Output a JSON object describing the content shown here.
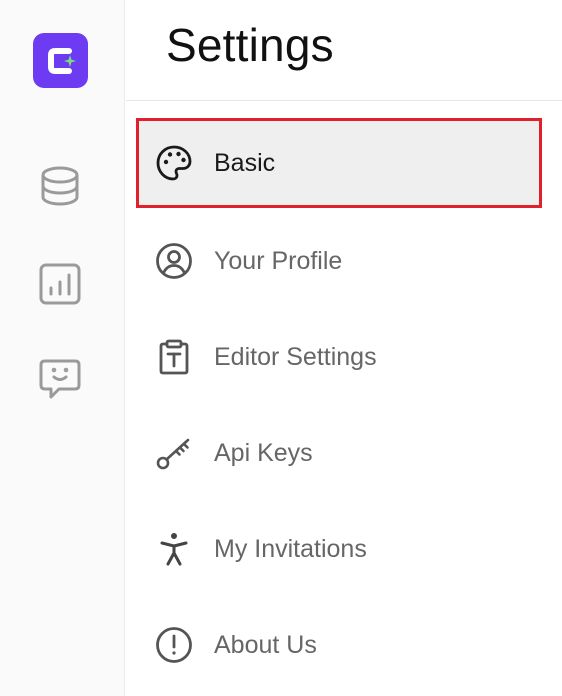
{
  "header": {
    "title": "Settings"
  },
  "colors": {
    "brand": "#6d3cf2",
    "accent_spark": "#7be07b",
    "highlight_border": "#e0202a"
  },
  "rail": {
    "items": [
      {
        "icon": "database-icon"
      },
      {
        "icon": "bar-chart-icon"
      },
      {
        "icon": "chat-bubble-icon"
      }
    ]
  },
  "menu": {
    "items": [
      {
        "label": "Basic",
        "icon": "palette-icon",
        "active": true
      },
      {
        "label": "Your Profile",
        "icon": "user-circle-icon"
      },
      {
        "label": "Editor Settings",
        "icon": "clipboard-text-icon"
      },
      {
        "label": "Api Keys",
        "icon": "key-icon"
      },
      {
        "label": "My Invitations",
        "icon": "accessibility-icon"
      },
      {
        "label": "About Us",
        "icon": "info-circle-icon"
      }
    ]
  }
}
